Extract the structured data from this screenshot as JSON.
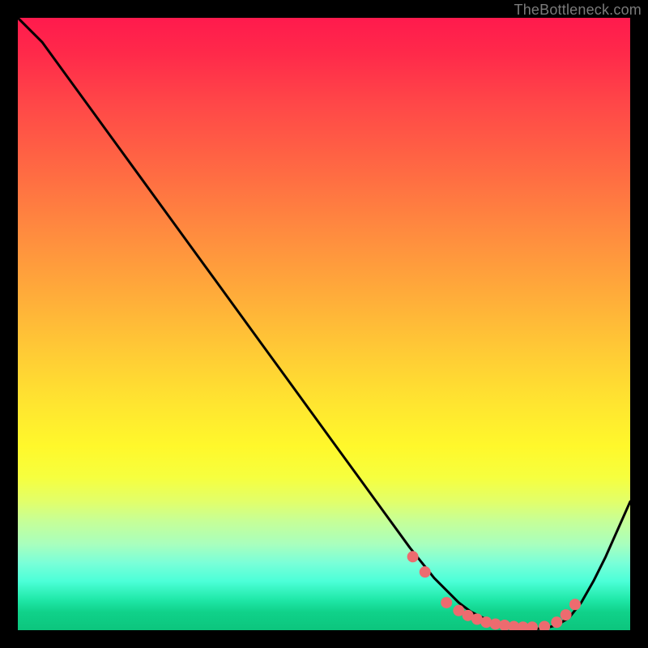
{
  "attribution": "TheBottleneck.com",
  "chart_data": {
    "type": "line",
    "title": "",
    "xlabel": "",
    "ylabel": "",
    "xlim": [
      0,
      100
    ],
    "ylim": [
      0,
      100
    ],
    "series": [
      {
        "name": "bottleneck-curve",
        "x": [
          0,
          4,
          8,
          12,
          16,
          20,
          24,
          28,
          32,
          36,
          40,
          44,
          48,
          52,
          56,
          60,
          64,
          66,
          68,
          70,
          72,
          74,
          76,
          78,
          80,
          82,
          84,
          86,
          88,
          90,
          92,
          94,
          96,
          98,
          100
        ],
        "y": [
          100,
          96,
          90.5,
          85,
          79.5,
          74,
          68.5,
          63,
          57.5,
          52,
          46.5,
          41,
          35.5,
          30,
          24.5,
          19,
          13.5,
          11,
          8.5,
          6.5,
          4.5,
          3,
          2,
          1.2,
          0.6,
          0.3,
          0.2,
          0.3,
          0.8,
          2,
          4.5,
          8,
          12,
          16.5,
          21
        ]
      }
    ],
    "markers": {
      "name": "plateau-dots",
      "x": [
        64.5,
        66.5,
        70,
        72,
        73.5,
        75,
        76.5,
        78,
        79.5,
        81,
        82.5,
        84,
        86,
        88,
        89.5,
        91
      ],
      "y": [
        12,
        9.5,
        4.5,
        3.2,
        2.4,
        1.8,
        1.3,
        1.0,
        0.8,
        0.6,
        0.5,
        0.5,
        0.6,
        1.3,
        2.5,
        4.2
      ]
    },
    "background_gradient_stops": [
      {
        "pos": 0.0,
        "color": "#ff1a4d"
      },
      {
        "pos": 0.5,
        "color": "#ffcc35"
      },
      {
        "pos": 0.75,
        "color": "#f6ff3e"
      },
      {
        "pos": 1.0,
        "color": "#0cc57d"
      }
    ],
    "marker_color": "#ed6b6f",
    "curve_color": "#000000"
  }
}
